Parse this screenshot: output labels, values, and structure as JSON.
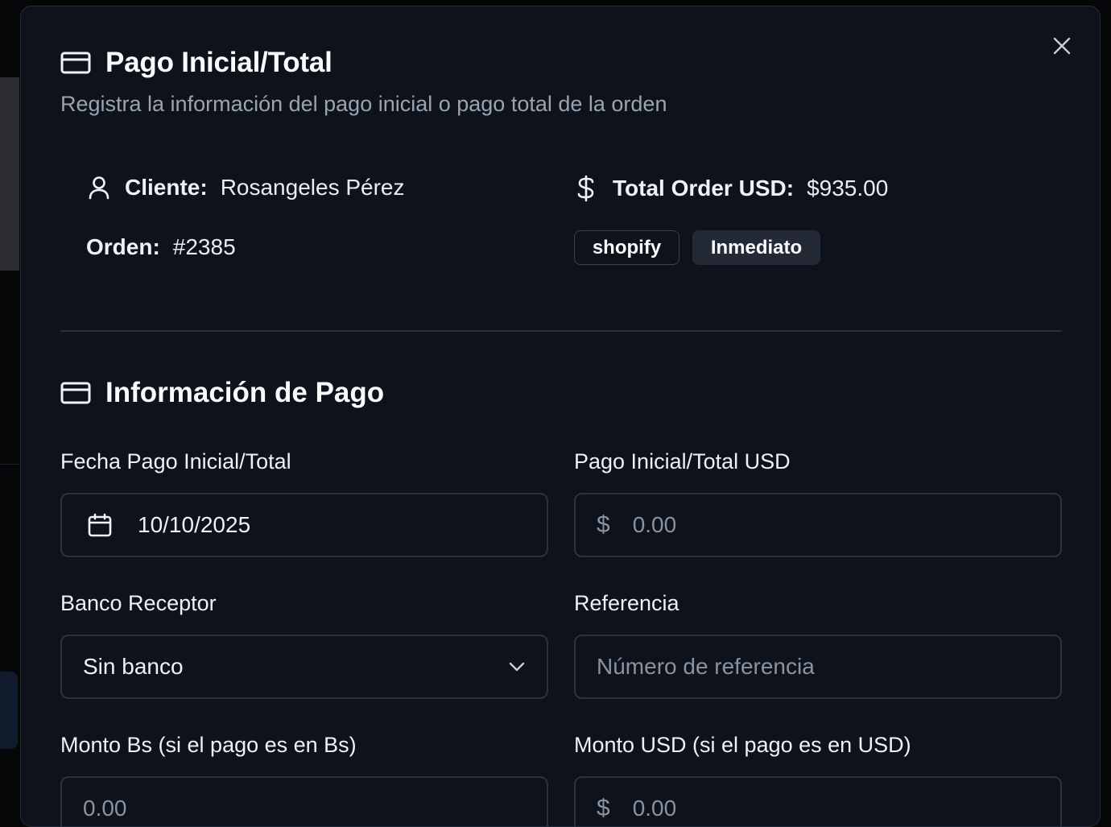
{
  "dialog": {
    "title": "Pago Inicial/Total",
    "subtitle": "Registra la información del pago inicial o pago total de la orden",
    "close_icon": "close-icon"
  },
  "order_info": {
    "cliente_label": "Cliente:",
    "cliente_value": "Rosangeles Pérez",
    "total_label": "Total Order USD:",
    "total_value": "$935.00",
    "orden_label": "Orden:",
    "orden_value": "#2385",
    "badges": [
      "shopify",
      "Inmediato"
    ]
  },
  "payment_section": {
    "title": "Información de Pago",
    "fecha": {
      "label": "Fecha Pago Inicial/Total",
      "value": "10/10/2025"
    },
    "pago_usd": {
      "label": "Pago Inicial/Total USD",
      "prefix": "$",
      "placeholder": "0.00"
    },
    "banco": {
      "label": "Banco Receptor",
      "value": "Sin banco"
    },
    "referencia": {
      "label": "Referencia",
      "placeholder": "Número de referencia"
    },
    "monto_bs": {
      "label": "Monto Bs (si el pago es en Bs)",
      "placeholder": "0.00"
    },
    "monto_usd": {
      "label": "Monto USD (si el pago es en USD)",
      "prefix": "$",
      "placeholder": "0.00"
    }
  },
  "colors": {
    "modal_bg": "#0d121b",
    "border": "#2c333f",
    "muted_text": "#9aa3b2",
    "badge_bg": "#232a36"
  }
}
